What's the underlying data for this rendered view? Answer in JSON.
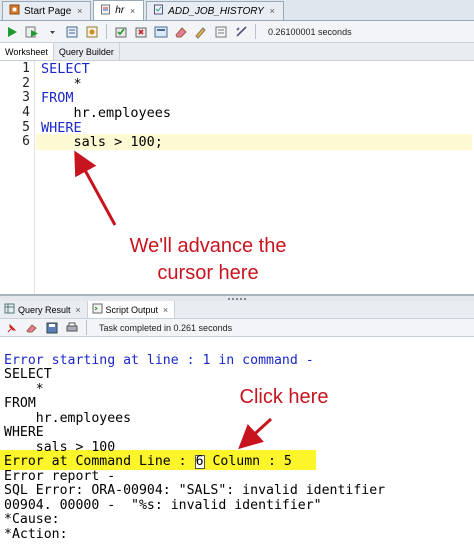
{
  "tabs": [
    {
      "label": "Start Page"
    },
    {
      "label": "hr"
    },
    {
      "label": "ADD_JOB_HISTORY"
    }
  ],
  "toolbar": {
    "status": "0.26100001 seconds"
  },
  "worksheet_tabs": [
    {
      "label": "Worksheet"
    },
    {
      "label": "Query Builder"
    }
  ],
  "editor": {
    "line_numbers": [
      "1",
      "2",
      "3",
      "4",
      "5",
      "6"
    ],
    "lines": [
      "SELECT",
      "    *",
      "FROM",
      "    hr.employees",
      "WHERE",
      "    sals > 100;"
    ]
  },
  "annotations": {
    "cursor_note_1": "We'll advance the",
    "cursor_note_2": "cursor here",
    "click_note": "Click here"
  },
  "colors": {
    "annotation": "#c8141e",
    "keyword": "#1b28c8",
    "highlight": "#fbf52a"
  },
  "output_tabs": [
    {
      "label": "Query Result"
    },
    {
      "label": "Script Output"
    }
  ],
  "output_toolbar": {
    "status": "Task completed in 0.261 seconds"
  },
  "output": {
    "l1": "Error starting at line : 1 in command -",
    "l2": "SELECT",
    "l3": "    *",
    "l4": "FROM",
    "l5": "    hr.employees",
    "l6": "WHERE",
    "l7": "    sals > 100",
    "l8a": "Error at Command Line : ",
    "l8b": "6",
    "l8c": " Column : 5",
    "l9": "Error report -",
    "l10": "SQL Error: ORA-00904: \"SALS\": invalid identifier",
    "l11": "00904. 00000 -  \"%s: invalid identifier\"",
    "l12": "*Cause:",
    "l13": "*Action:"
  }
}
